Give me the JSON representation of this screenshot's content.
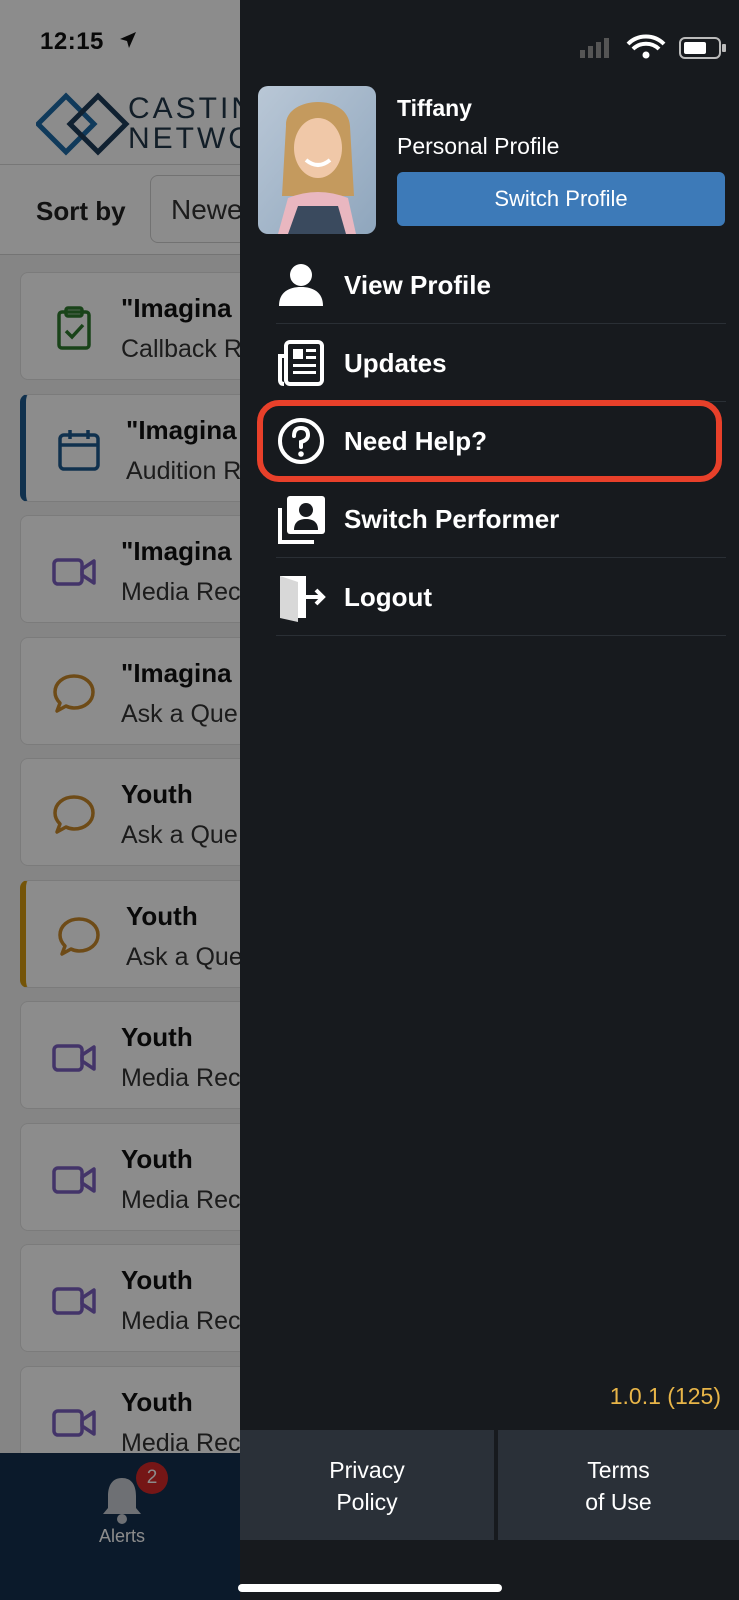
{
  "status_bar": {
    "time": "12:15"
  },
  "app": {
    "logo_text_line1": "CASTIN",
    "logo_text_line2": "NETWO",
    "sort": {
      "label": "Sort by",
      "selected": "Newe"
    },
    "cards": [
      {
        "title": "\"Imagina",
        "subtitle": "Callback R",
        "icon": "clipboard-check-icon",
        "icon_color": "#2f7a2f",
        "accent": "none"
      },
      {
        "title": "\"Imagina",
        "subtitle": "Audition R",
        "icon": "calendar-icon",
        "icon_color": "#1e5a8e",
        "accent": "blue"
      },
      {
        "title": "\"Imagina",
        "subtitle": "Media Rec",
        "icon": "video-camera-icon",
        "icon_color": "#7b5fc0",
        "accent": "none"
      },
      {
        "title": "\"Imagina",
        "subtitle": "Ask a Que",
        "icon": "chat-bubble-icon",
        "icon_color": "#c9892a",
        "accent": "none"
      },
      {
        "title": "Youth",
        "subtitle": "Ask a Que",
        "icon": "chat-bubble-icon",
        "icon_color": "#c9892a",
        "accent": "none"
      },
      {
        "title": "Youth",
        "subtitle": "Ask a Que",
        "icon": "chat-bubble-icon",
        "icon_color": "#c9892a",
        "accent": "gold"
      },
      {
        "title": "Youth",
        "subtitle": "Media Rec",
        "icon": "video-camera-icon",
        "icon_color": "#7b5fc0",
        "accent": "none"
      },
      {
        "title": "Youth",
        "subtitle": "Media Rec",
        "icon": "video-camera-icon",
        "icon_color": "#7b5fc0",
        "accent": "none"
      },
      {
        "title": "Youth",
        "subtitle": "Media Rec",
        "icon": "video-camera-icon",
        "icon_color": "#7b5fc0",
        "accent": "none"
      },
      {
        "title": "Youth",
        "subtitle": "Media Rec",
        "icon": "video-camera-icon",
        "icon_color": "#7b5fc0",
        "accent": "none"
      }
    ],
    "tabbar": {
      "alerts_label": "Alerts",
      "alerts_badge": "2"
    }
  },
  "drawer": {
    "profile": {
      "name": "Tiffany",
      "type": "Personal Profile",
      "switch_label": "Switch Profile"
    },
    "menu": [
      {
        "label": "View Profile",
        "icon": "person-icon"
      },
      {
        "label": "Updates",
        "icon": "newspaper-icon"
      },
      {
        "label": "Need Help?",
        "icon": "question-circle-icon",
        "highlighted": true
      },
      {
        "label": "Switch Performer",
        "icon": "switch-performer-icon"
      },
      {
        "label": "Logout",
        "icon": "logout-door-icon"
      }
    ],
    "version": "1.0.1 (125)",
    "footer": {
      "privacy": "Privacy Policy",
      "terms": "Terms of Use"
    }
  },
  "colors": {
    "drawer_bg": "#171a1e",
    "switch_button": "#3d7ab8",
    "highlight": "#e8402a",
    "version_text": "#e8b548",
    "tabbar_bg": "#14304f"
  }
}
